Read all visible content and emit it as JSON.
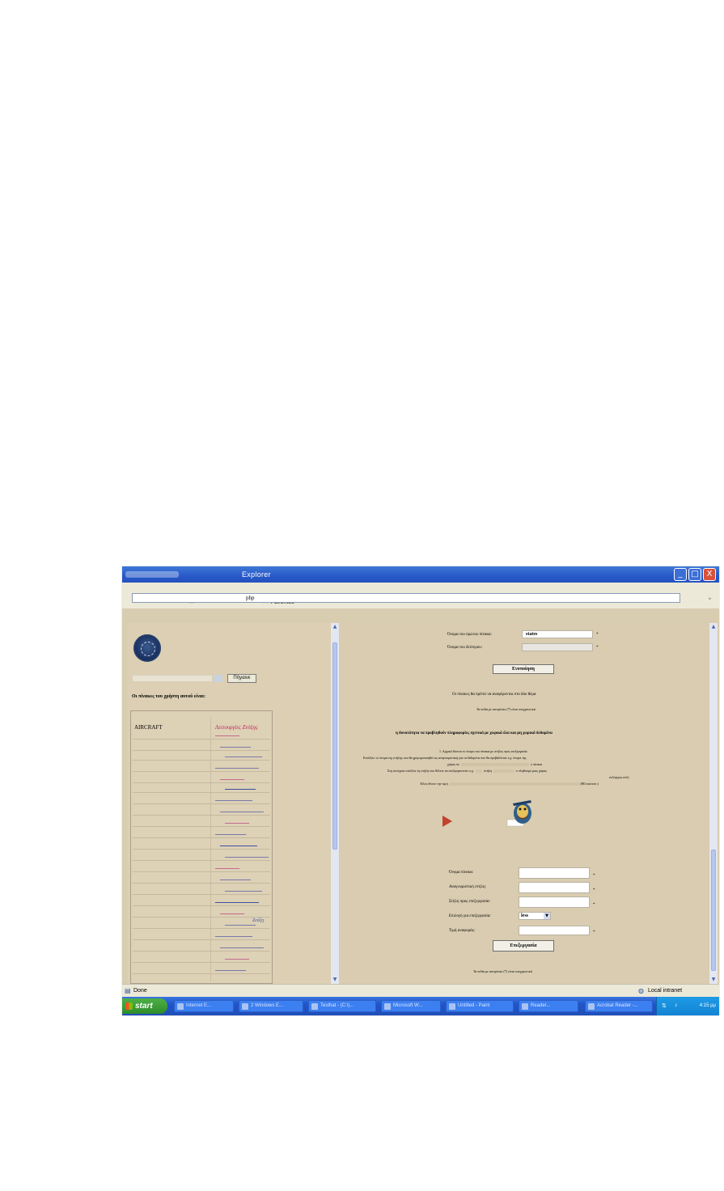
{
  "window": {
    "title": "Explorer",
    "controls": {
      "minimize": "_",
      "maximize": "□",
      "close": "X"
    }
  },
  "toolbar": {
    "favorites_label": "Favorites",
    "address_value": "php"
  },
  "left_frame": {
    "go_button": "Πήγαινε",
    "tables_label": "Οι πίνακες του χρήστη αυτού είναι:",
    "table_header_left": "AIRCRAFT",
    "table_header_right": "Λειτουργίες Ζεύξης",
    "zeus_label": "Ζεύξη"
  },
  "right_frame": {
    "first_table_label": "Όνομα του πρώτου πίνακα:",
    "first_table_value": "states",
    "second_table_label": "Όνομα του δεύτερου:",
    "join_button": "Ενοποίηση",
    "info_1": "Οι πίνακες θα πρέπει να αναφέρονται στο ίδιο θέμα",
    "required_note": "Τα πεδία με αστερίσκο (*) είναι υποχρεωτικά",
    "section_heading": "η δυνατότητα να προβληθούν πληροφορίες σχετικά με χωρικά όλα και μη χωρικά δεδομένα",
    "step_1": "1.   Αρχικά δίνεται το όνομα του πίνακα με στήλες προς επεξεργασία",
    "step_2": "Επιλέξτε το όνομα της στήλης που θα χρησιμοποιηθεί ως αναγνωριστική για τα δεδομένα που θα προβάλλεται π.χ. όνομα της",
    "step_2b": "χώρας σε",
    "step_2c": "ο πίνακα",
    "step_3": "Στη συνέχεια επιλέξτε τη στήλη που θέλετε να επεξεργαστείτε π.χ.",
    "step_3b": "στήλη",
    "step_3c": "ο πληθυσμό μιας χώρας",
    "step_3d": "εκλόγιμος κλπ)",
    "step_4": "Τέλος δίνετε την τιμή",
    "step_4b": "(Β0 εκατοστ.)",
    "form": {
      "table_name_label": "Όνομα πίνακα:",
      "id_column_label": "Αναγνωριστική στήλη:",
      "process_column_label": "Στήλη προς επεξεργασία:",
      "choice_label": "Επιλογή για επεξεργασία:",
      "choice_value": "less",
      "value_label": "Τιμή αναφοράς:",
      "process_button": "Επεξεργασία",
      "required_note": "Τα πεδία με αστερίσκο (*) είναι υποχρεωτικά",
      "asterisk": "*"
    }
  },
  "statusbar": {
    "status": "Done",
    "zone": "Local intranet"
  },
  "taskbar": {
    "start": "start",
    "tasks": [
      "Internet E...",
      "2 Windows E...",
      "Testhat - (C:\\)...",
      "Microsoft W...",
      "Untitled - Paint",
      "Reader...",
      "Acrobat Reader -..."
    ],
    "clock": "4:15 μμ"
  },
  "colors": {
    "page_bg": "#d9ccb0",
    "titlebar": "#2858c8",
    "accent_red": "#c2255e",
    "taskbar": "#2154c8",
    "start_green": "#3a9b34"
  }
}
